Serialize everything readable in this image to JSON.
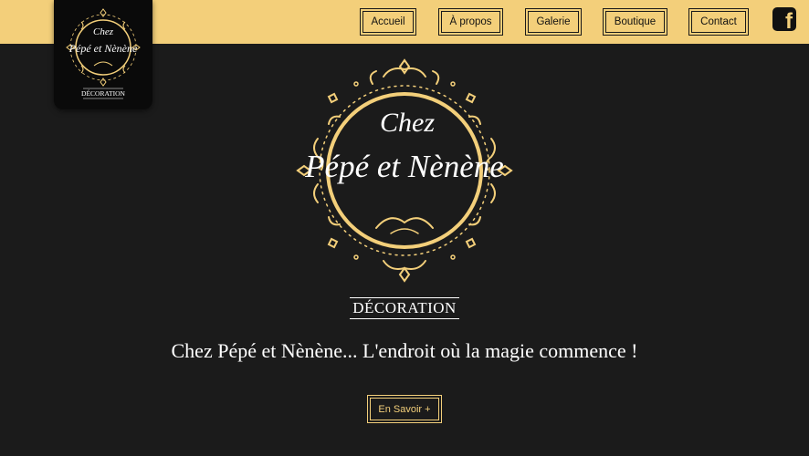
{
  "nav": {
    "items": [
      {
        "label": "Accueil"
      },
      {
        "label": "À propos"
      },
      {
        "label": "Galerie"
      },
      {
        "label": "Boutique"
      },
      {
        "label": "Contact"
      }
    ],
    "facebook_icon": "facebook-icon"
  },
  "logo": {
    "line1": "Chez",
    "line2": "Pépé et Nènène",
    "subtitle": "DÉCORATION"
  },
  "hero": {
    "emblem_line1": "Chez",
    "emblem_line2": "Pépé et Nènène",
    "subtitle": "DÉCORATION",
    "tagline": "Chez Pépé et Nènène... L'endroit où la magie commence !",
    "cta_label": "En Savoir +"
  },
  "colors": {
    "gold": "#f3cf7a",
    "background": "#1b1b1b",
    "header": "#f3cf7a"
  }
}
